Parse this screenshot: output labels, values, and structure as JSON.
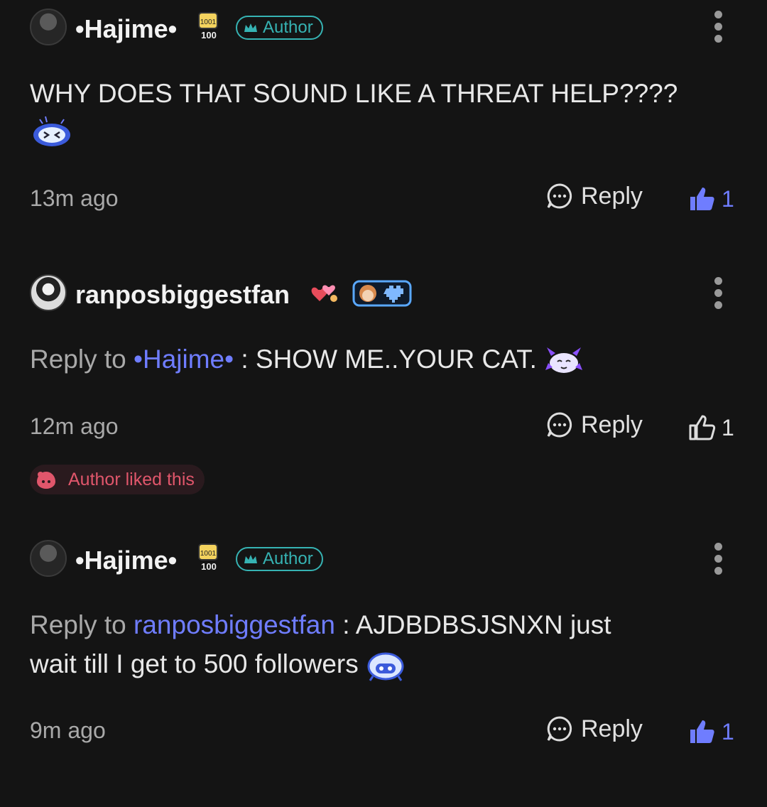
{
  "comments": [
    {
      "username": "•Hajime•",
      "author_badge": "Author",
      "text": "WHY DOES THAT SOUND LIKE A THREAT HELP????",
      "time": "13m ago",
      "reply_label": "Reply",
      "likes": "1"
    },
    {
      "username": "ranposbiggestfan",
      "reply_to_prefix": "Reply to",
      "reply_to_user": "•Hajime•",
      "text": ": SHOW ME..YOUR CAT.",
      "time": "12m ago",
      "reply_label": "Reply",
      "likes": "1",
      "author_liked": "Author liked this"
    },
    {
      "username": "•Hajime•",
      "author_badge": "Author",
      "reply_to_prefix": "Reply to",
      "reply_to_user": "ranposbiggestfan",
      "text_line1": ": AJDBDBSJSNXN just",
      "text_line2": "wait till I get to 500 followers",
      "time": "9m ago",
      "reply_label": "Reply",
      "likes": "1"
    }
  ],
  "colors": {
    "accent": "#6f7dff",
    "author": "#36b3b3",
    "liked": "#e0566b"
  }
}
